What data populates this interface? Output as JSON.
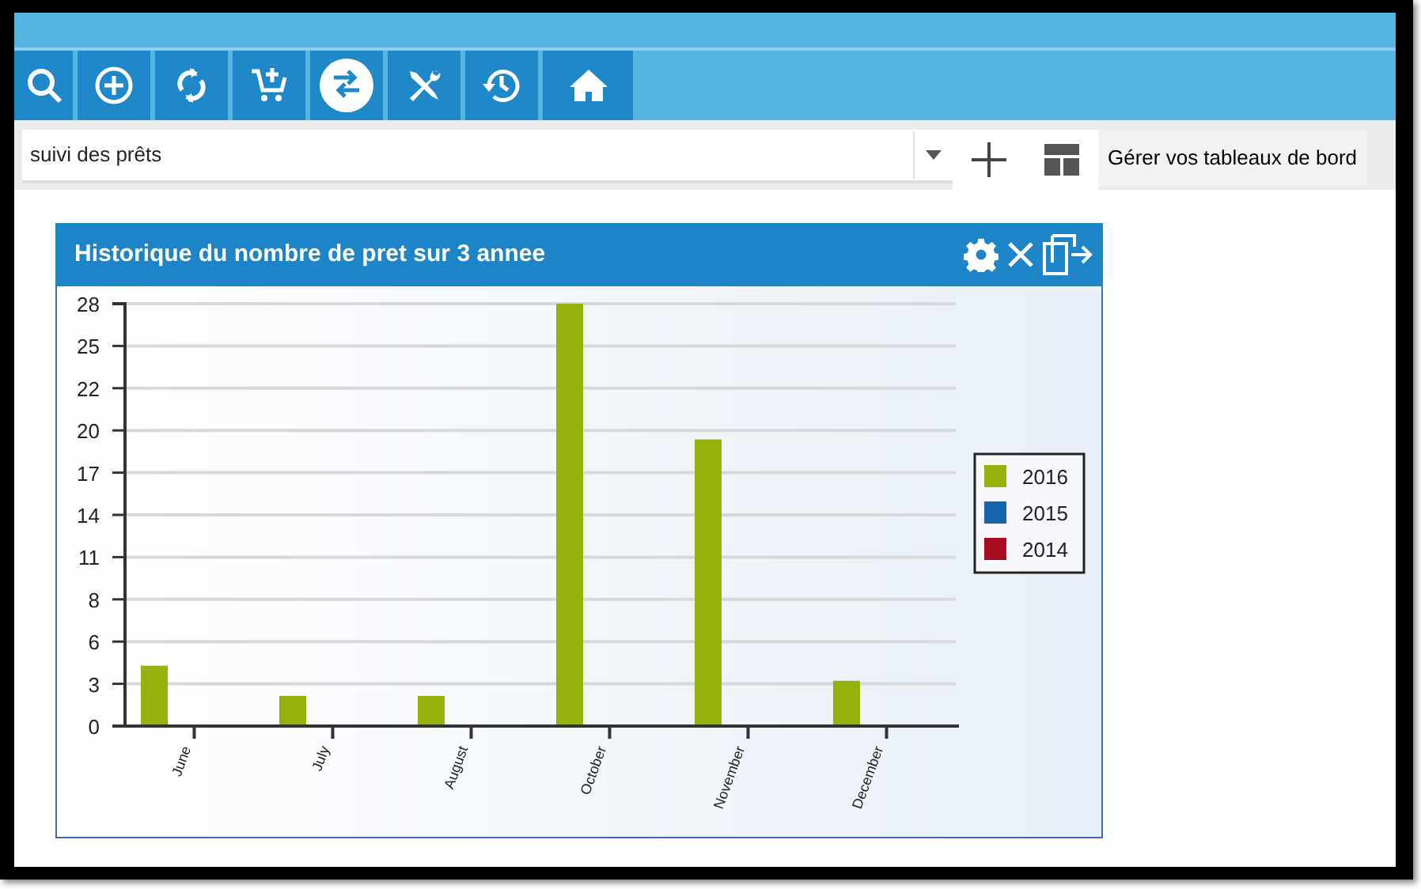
{
  "toolbar": [
    {
      "kind": "search",
      "selected": false
    },
    {
      "kind": "add",
      "selected": false
    },
    {
      "kind": "refresh",
      "selected": false
    },
    {
      "kind": "cart",
      "selected": false
    },
    {
      "kind": "exchange",
      "selected": true
    },
    {
      "kind": "tools",
      "selected": false
    },
    {
      "kind": "history",
      "selected": false
    },
    {
      "kind": "home",
      "selected": false
    }
  ],
  "dashboard_select": {
    "value": "suivi des prêts"
  },
  "manage_label": "Gérer vos tableaux de bord",
  "panel": {
    "title": "Historique du nombre de pret sur 3 annee",
    "chart_data": {
      "type": "bar",
      "categories": [
        "June",
        "July",
        "August",
        "October",
        "November",
        "December"
      ],
      "series": [
        {
          "name": "2016",
          "color": "#95b10c",
          "values": [
            4,
            2,
            2,
            28,
            19,
            3
          ]
        },
        {
          "name": "2015",
          "color": "#1665ae",
          "values": [
            null,
            null,
            null,
            null,
            null,
            null
          ]
        },
        {
          "name": "2014",
          "color": "#a50d1e",
          "values": [
            null,
            null,
            null,
            null,
            null,
            null
          ]
        }
      ],
      "grid": true,
      "ylim": [
        0,
        28
      ],
      "yticks": [
        0,
        {
          "value": 2.8,
          "label": "3"
        },
        {
          "value": 5.6,
          "label": "6"
        },
        {
          "value": 8.4,
          "label": "8"
        },
        {
          "value": 11.2,
          "label": "11"
        },
        {
          "value": 14,
          "label": "14"
        },
        {
          "value": 16.8,
          "label": "17"
        },
        {
          "value": 19.6,
          "label": "20"
        },
        {
          "value": 22.4,
          "label": "22"
        },
        {
          "value": 25.2,
          "label": "25"
        },
        28
      ]
    }
  }
}
